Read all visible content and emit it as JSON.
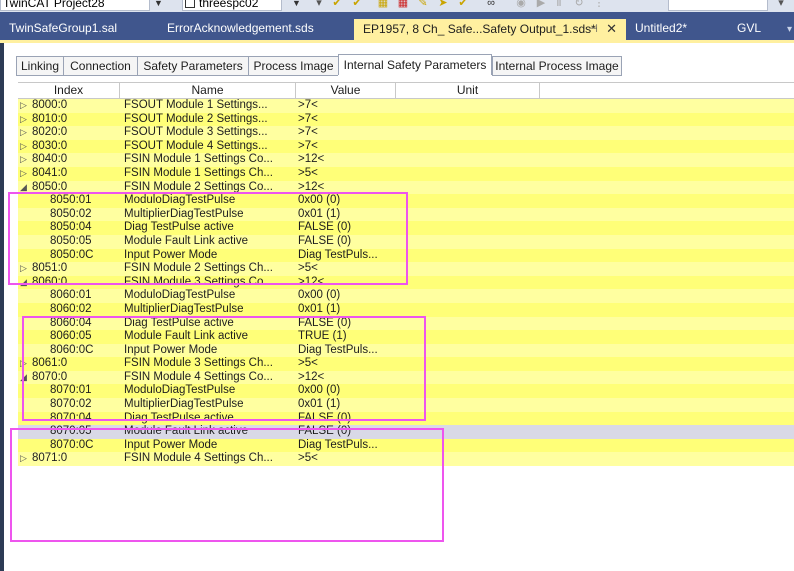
{
  "toolbar": {
    "project_combo": "TwinCAT Project28",
    "target_combo": "threespc02"
  },
  "doc_tabs": [
    {
      "label": "TwinSafeGroup1.sal",
      "active": false
    },
    {
      "label": "ErrorAcknowledgement.sds",
      "active": false
    },
    {
      "label": "EP1957, 8 Ch_ Safe...Safety Output_1.sds*",
      "active": true
    },
    {
      "label": "Untitled2*",
      "active": false
    },
    {
      "label": "GVL",
      "active": false
    }
  ],
  "subtabs": [
    {
      "label": "Linking"
    },
    {
      "label": "Connection"
    },
    {
      "label": "Safety Parameters"
    },
    {
      "label": "Process Image"
    },
    {
      "label": "Internal Safety Parameters",
      "active": true
    },
    {
      "label": "Internal Process Image"
    }
  ],
  "grid": {
    "columns": [
      "Index",
      "Name",
      "Value",
      "Unit"
    ],
    "rows": [
      {
        "index": "8000:0",
        "name": "FSOUT Module   1 Settings...",
        "value": ">7<",
        "expander": "collapsed"
      },
      {
        "index": "8010:0",
        "name": "FSOUT Module   2 Settings...",
        "value": ">7<",
        "expander": "collapsed"
      },
      {
        "index": "8020:0",
        "name": "FSOUT Module   3 Settings...",
        "value": ">7<",
        "expander": "collapsed"
      },
      {
        "index": "8030:0",
        "name": "FSOUT Module   4 Settings...",
        "value": ">7<",
        "expander": "collapsed"
      },
      {
        "index": "8040:0",
        "name": "FSIN Module   1 Settings Co...",
        "value": ">12<",
        "expander": "collapsed"
      },
      {
        "index": "8041:0",
        "name": "FSIN Module   1 Settings Ch...",
        "value": ">5<",
        "expander": "collapsed"
      },
      {
        "index": "8050:0",
        "name": "FSIN Module   2 Settings Co...",
        "value": ">12<",
        "expander": "expanded"
      },
      {
        "index": "8050:01",
        "name": "ModuloDiagTestPulse",
        "value": "0x00 (0)",
        "expander": "none"
      },
      {
        "index": "8050:02",
        "name": "MultiplierDiagTestPulse",
        "value": "0x01 (1)",
        "expander": "none"
      },
      {
        "index": "8050:04",
        "name": "Diag TestPulse active",
        "value": "FALSE (0)",
        "expander": "none"
      },
      {
        "index": "8050:05",
        "name": "Module Fault Link active",
        "value": "FALSE (0)",
        "expander": "none"
      },
      {
        "index": "8050:0C",
        "name": "Input Power Mode",
        "value": "Diag TestPuls...",
        "expander": "none"
      },
      {
        "index": "8051:0",
        "name": "FSIN Module   2 Settings Ch...",
        "value": ">5<",
        "expander": "collapsed"
      },
      {
        "index": "8060:0",
        "name": "FSIN Module   3 Settings Co...",
        "value": ">12<",
        "expander": "expanded"
      },
      {
        "index": "8060:01",
        "name": "ModuloDiagTestPulse",
        "value": "0x00 (0)",
        "expander": "none"
      },
      {
        "index": "8060:02",
        "name": "MultiplierDiagTestPulse",
        "value": "0x01 (1)",
        "expander": "none"
      },
      {
        "index": "8060:04",
        "name": "Diag TestPulse active",
        "value": "FALSE (0)",
        "expander": "none"
      },
      {
        "index": "8060:05",
        "name": "Module Fault Link active",
        "value": "TRUE (1)",
        "expander": "none"
      },
      {
        "index": "8060:0C",
        "name": "Input Power Mode",
        "value": "Diag TestPuls...",
        "expander": "none"
      },
      {
        "index": "8061:0",
        "name": "FSIN Module   3 Settings Ch...",
        "value": ">5<",
        "expander": "collapsed"
      },
      {
        "index": "8070:0",
        "name": "FSIN Module   4 Settings Co...",
        "value": ">12<",
        "expander": "expanded"
      },
      {
        "index": "8070:01",
        "name": "ModuloDiagTestPulse",
        "value": "0x00 (0)",
        "expander": "none"
      },
      {
        "index": "8070:02",
        "name": "MultiplierDiagTestPulse",
        "value": "0x01 (1)",
        "expander": "none"
      },
      {
        "index": "8070:04",
        "name": "Diag TestPulse active",
        "value": "FALSE (0)",
        "expander": "none"
      },
      {
        "index": "8070:05",
        "name": "Module Fault Link active",
        "value": "FALSE (0)",
        "expander": "none",
        "selected": true
      },
      {
        "index": "8070:0C",
        "name": "Input Power Mode",
        "value": "Diag TestPuls...",
        "expander": "none"
      },
      {
        "index": "8071:0",
        "name": "FSIN Module   4 Settings Ch...",
        "value": ">5<",
        "expander": "collapsed"
      }
    ]
  },
  "colors": {
    "row_light": "#ffffa0",
    "row_dark": "#ffff78",
    "active_tab": "#fff0a0",
    "highlight_box": "#ee55ee",
    "tab_strip": "#40568d"
  }
}
